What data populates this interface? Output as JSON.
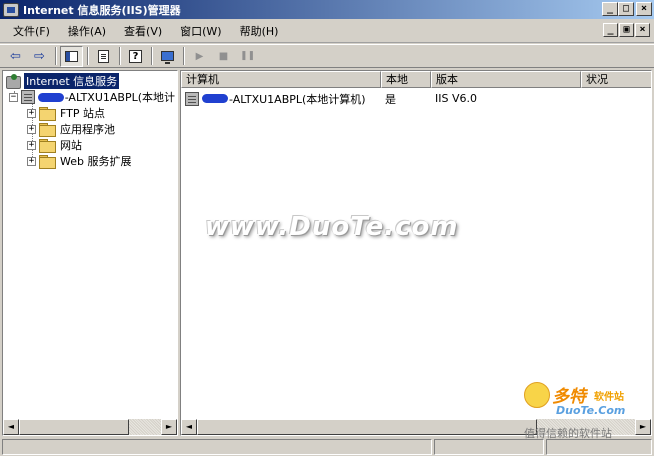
{
  "window": {
    "title": "Internet 信息服务(IIS)管理器",
    "caption_min": "_",
    "caption_max": "□",
    "caption_close": "×"
  },
  "menu": {
    "items": [
      "文件(F)",
      "操作(A)",
      "查看(V)",
      "窗口(W)",
      "帮助(H)"
    ],
    "mdi_min": "_",
    "mdi_restore": "▣",
    "mdi_close": "×"
  },
  "toolbar": {
    "buttons": [
      "back-arrow-icon",
      "forward-arrow-icon",
      "show-hide-tree-icon",
      "export-list-icon",
      "help-icon",
      "computer-icon",
      "play-icon",
      "stop-icon",
      "pause-icon"
    ],
    "back": "⇦",
    "forward": "⇨",
    "help": "?",
    "play": "▶",
    "stop": "■",
    "pause": "❚❚"
  },
  "tree": {
    "root": "Internet 信息服务",
    "server": "-ALTXU1ABPL(本地计",
    "children": [
      "FTP 站点",
      "应用程序池",
      "网站",
      "Web 服务扩展"
    ],
    "expander_collapsed": "+",
    "expander_expanded": "−"
  },
  "list": {
    "columns": [
      "计算机",
      "本地",
      "版本",
      "状况"
    ],
    "rows": [
      {
        "computer": "-ALTXU1ABPL(本地计算机)",
        "local": "是",
        "version": "IIS V6.0",
        "status": ""
      }
    ]
  },
  "watermark": {
    "text": "www.DuoTe.com",
    "logo_big": "多特",
    "logo_small": "软件站",
    "logo_url": "DuoTe.Com",
    "logo_slogan": "值得信赖的软件站"
  },
  "scroll": {
    "left": "◄",
    "right": "►"
  }
}
